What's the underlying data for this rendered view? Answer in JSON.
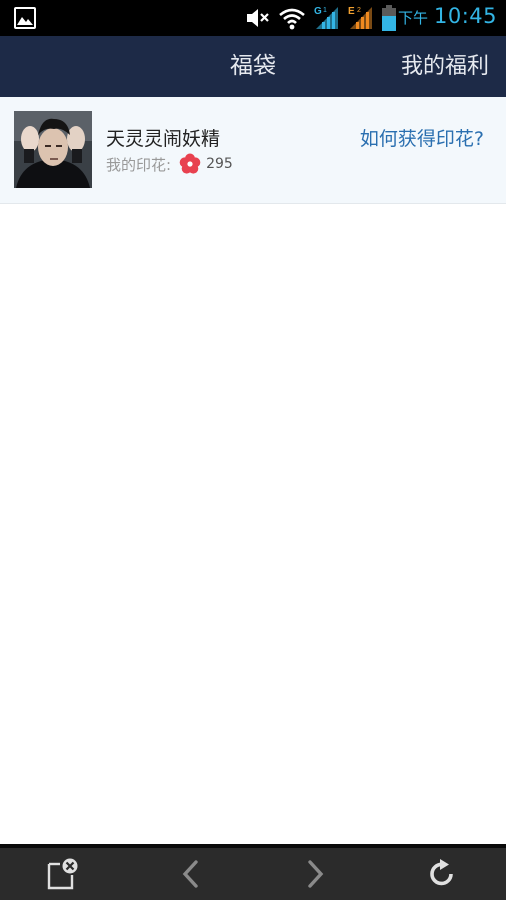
{
  "status_bar": {
    "ampm": "下午",
    "time": "10:45",
    "network_1": "G",
    "network_2": "E",
    "sim_1": "1",
    "sim_2": "2",
    "accent_color": "#33b5e5",
    "icons": [
      "gallery-notification-icon",
      "mute-icon",
      "wifi-icon",
      "signal-sim1-icon",
      "signal-sim2-icon",
      "battery-icon"
    ]
  },
  "navbar": {
    "title": "福袋",
    "right_action": "我的福利",
    "background_color": "#1d2a47"
  },
  "profile": {
    "username": "天灵灵闹妖精",
    "stamps_label": "我的印花:",
    "stamps_count": "295",
    "how_to_get_link": "如何获得印花?",
    "stamp_icon": "flower-stamp-icon",
    "link_color": "#2a6fb0"
  },
  "bottom_bar": {
    "icons": [
      "close-page-icon",
      "back-arrow-icon",
      "forward-arrow-icon",
      "refresh-icon"
    ]
  }
}
